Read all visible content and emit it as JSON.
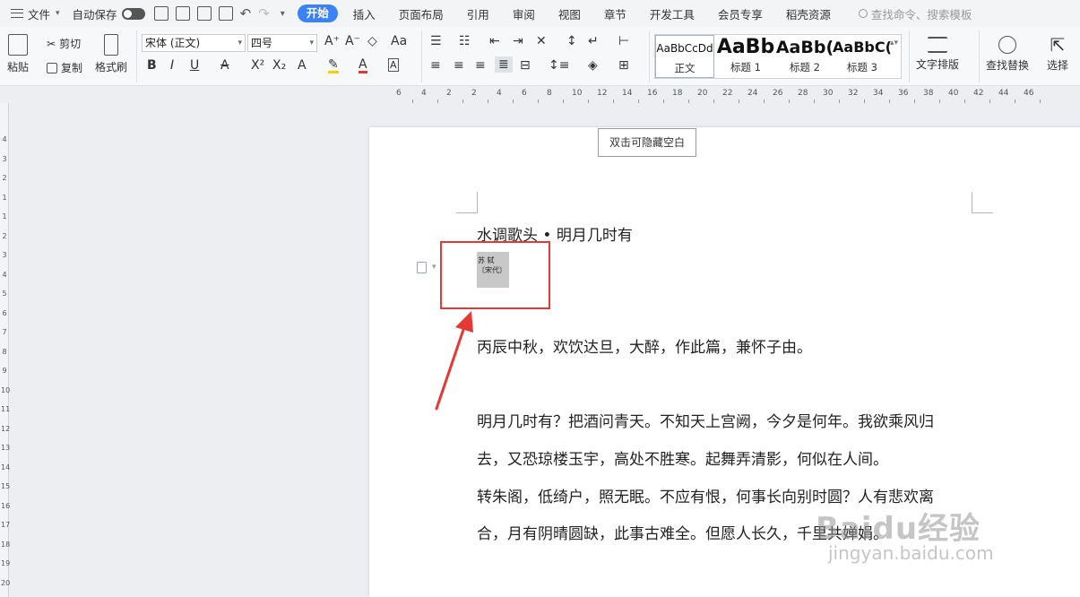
{
  "menubar": {
    "file_label": "文件",
    "autosave_label": "自动保存",
    "tabs": [
      "开始",
      "插入",
      "页面布局",
      "引用",
      "审阅",
      "视图",
      "章节",
      "开发工具",
      "会员专享",
      "稻壳资源"
    ],
    "active_tab": "开始",
    "search_placeholder": "查找命令、搜索模板"
  },
  "ribbon": {
    "paste_label": "粘贴",
    "cut_label": "剪切",
    "copy_label": "复制",
    "format_painter_label": "格式刷",
    "font_name": "宋体 (正文)",
    "font_size": "四号",
    "styles": [
      {
        "preview": "AaBbCcDd",
        "name": "正文"
      },
      {
        "preview": "AaBb",
        "name": "标题 1"
      },
      {
        "preview": "AaBb(",
        "name": "标题 2"
      },
      {
        "preview": "AaBbC(",
        "name": "标题 3"
      }
    ],
    "text_layout_label": "文字排版",
    "find_replace_label": "查找替换",
    "select_label": "选择"
  },
  "ruler": {
    "top_ticks": [
      "6",
      "4",
      "2",
      "2",
      "4",
      "6",
      "8",
      "10",
      "12",
      "14",
      "16",
      "18",
      "20",
      "22",
      "24",
      "26",
      "28",
      "30",
      "32",
      "34",
      "36",
      "38",
      "40",
      "42",
      "44",
      "46"
    ],
    "left_ticks": [
      "4",
      "3",
      "2",
      "1",
      "1",
      "2",
      "3",
      "4",
      "5",
      "6",
      "7",
      "8",
      "9",
      "10",
      "11",
      "12",
      "13",
      "14",
      "15",
      "16",
      "17",
      "18",
      "19",
      "20"
    ]
  },
  "page": {
    "hide_blank_button": "双击可隐藏空白",
    "title": "水调歌头 • 明月几时有",
    "author_line1": "苏 轼",
    "author_line2": "〔宋代〕",
    "preface": "丙辰中秋，欢饮达旦，大醉，作此篇，兼怀子由。",
    "lines": [
      "明月几时有？把酒问青天。不知天上宫阙，今夕是何年。我欲乘风归",
      "去，又恐琼楼玉宇，高处不胜寒。起舞弄清影，何似在人间。",
      "转朱阁，低绮户，照无眠。不应有恨，何事长向别时圆？人有悲欢离",
      "合，月有阴晴圆缺，此事古难全。但愿人长久，千里共婵娟。"
    ]
  },
  "watermark": {
    "brand": "Baidu经验",
    "url": "jingyan.baidu.com"
  },
  "colors": {
    "accent": "#3b82f6",
    "highlight_box": "#e53935",
    "arrow": "#e53935"
  }
}
